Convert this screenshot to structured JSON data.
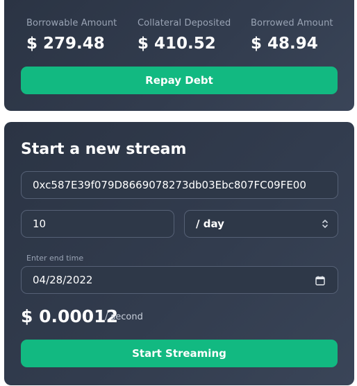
{
  "stats": {
    "borrowable_label": "Borrowable Amount",
    "borrowable_value": "$ 279.48",
    "collateral_label": "Collateral Deposited",
    "collateral_value": "$ 410.52",
    "borrowed_label": "Borrowed Amount",
    "borrowed_value": "$ 48.94",
    "repay_label": "Repay Debt"
  },
  "stream": {
    "title": "Start a new stream",
    "address_value": "0xc587E39f079D8669078273db03Ebc807FC09FE00",
    "amount_value": "10",
    "period_selected": "/ day",
    "end_time_label": "Enter end time",
    "end_time_value": "04/28/2022",
    "rate_value": "$ 0.00012",
    "rate_unit": "/ second",
    "start_label": "Start Streaming"
  },
  "colors": {
    "accent": "#12b981",
    "card_bg": "#2f3a4b",
    "muted_text": "#9aa4b5"
  }
}
